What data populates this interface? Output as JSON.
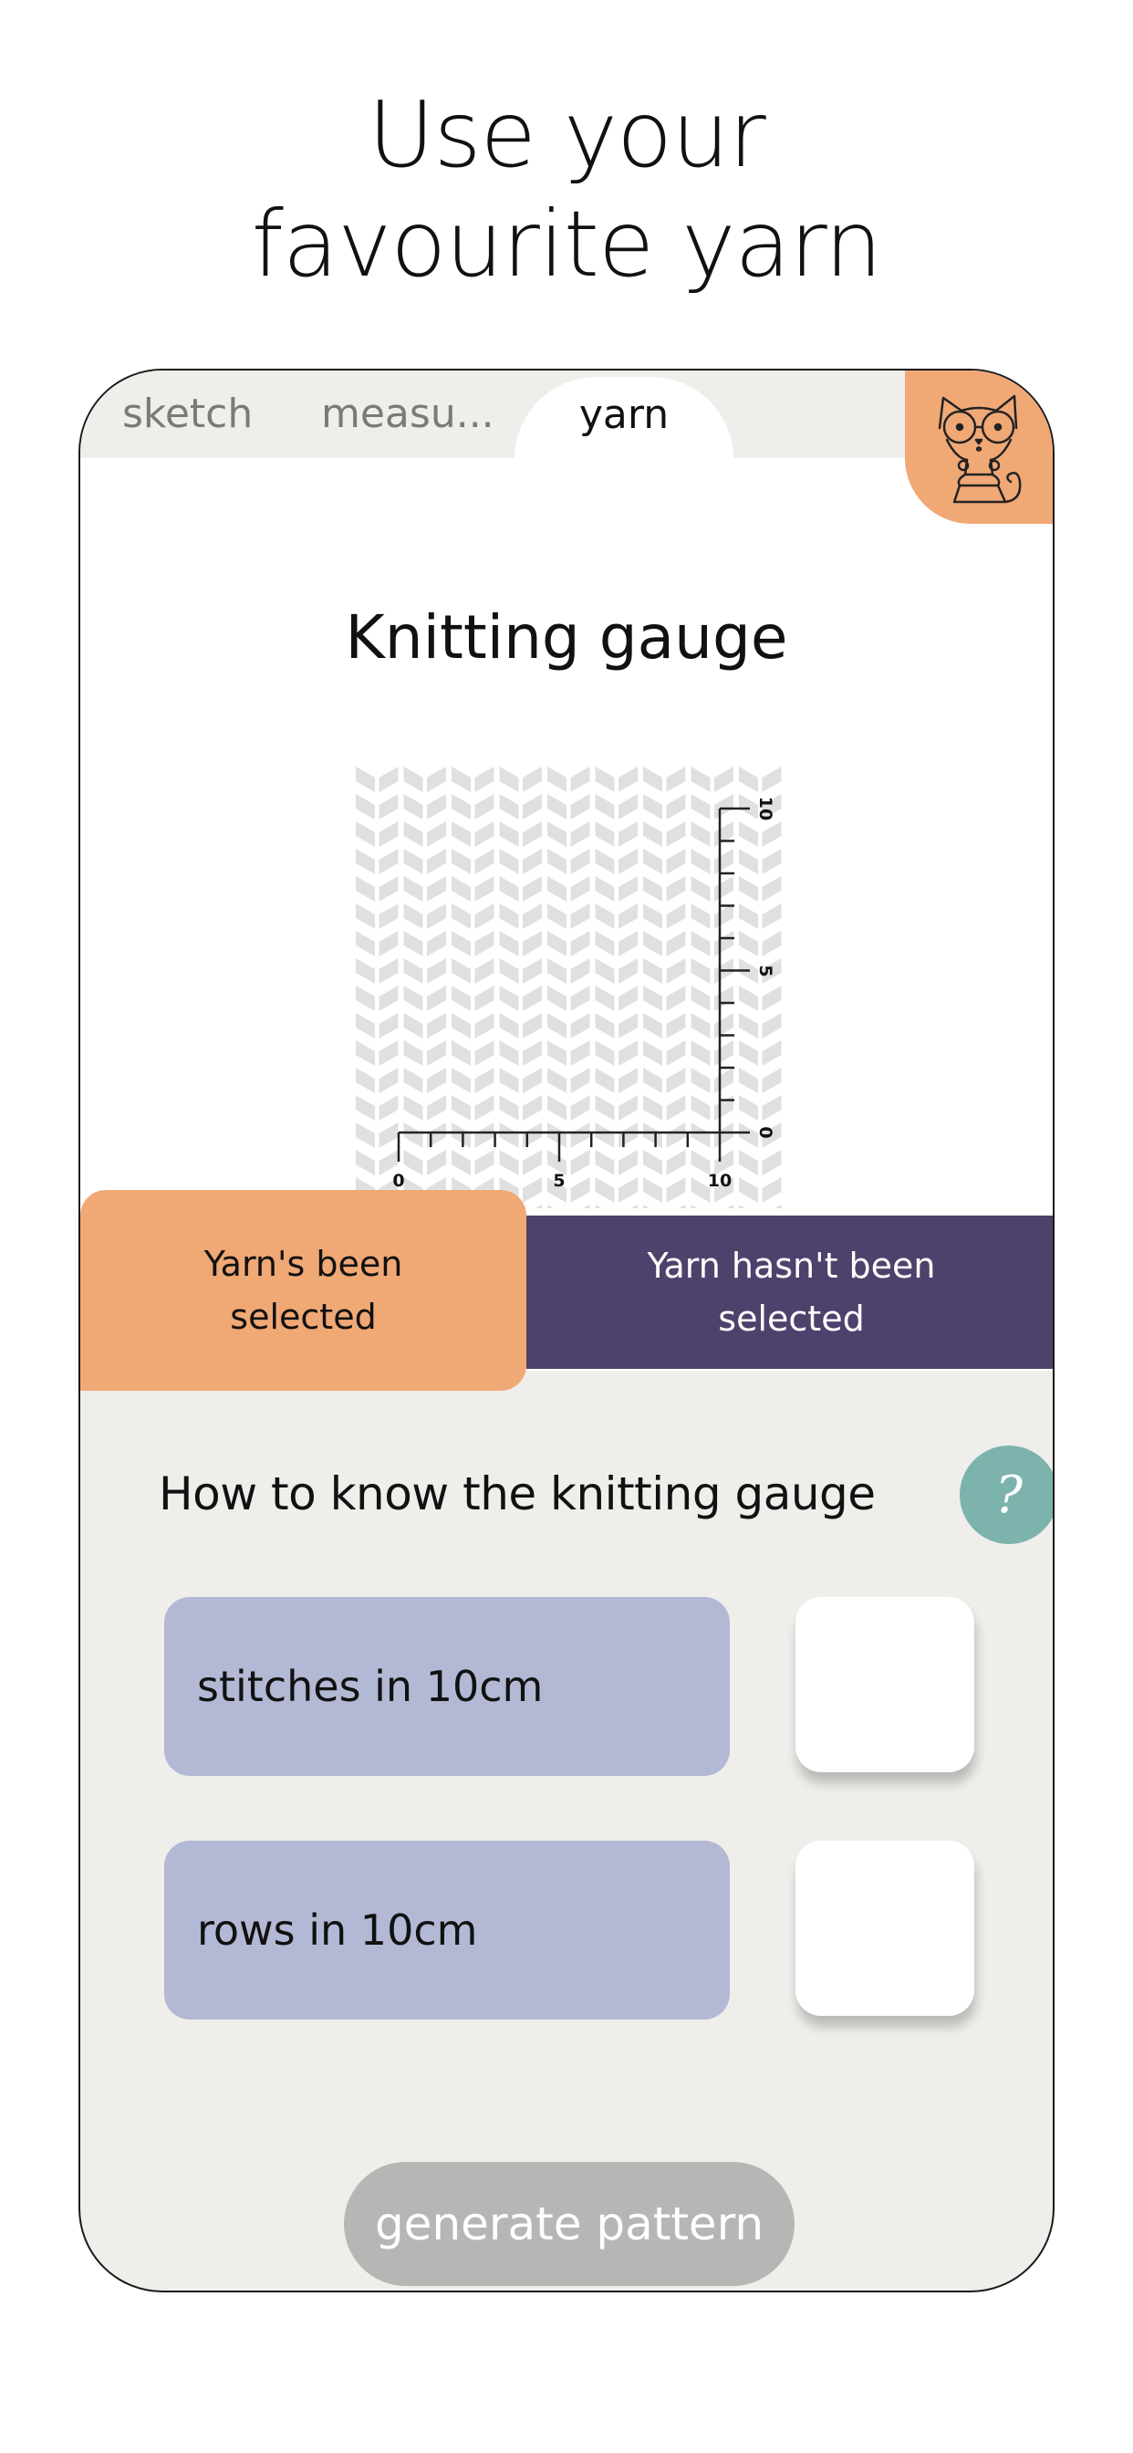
{
  "headline": {
    "line1": "Use your",
    "line2": "favourite yarn"
  },
  "tabs": [
    {
      "label": "sketch",
      "active": false
    },
    {
      "label": "measu...",
      "active": false
    },
    {
      "label": "yarn",
      "active": true
    }
  ],
  "mascot": {
    "icon": "cat-with-glasses-icon"
  },
  "gauge": {
    "title": "Knitting gauge",
    "illustration": {
      "icon": "knit-stitch-swatch",
      "horizontal_ruler_labels": [
        "0",
        "5",
        "10"
      ],
      "vertical_ruler_labels": [
        "0",
        "5",
        "10"
      ],
      "ruler_range": [
        0,
        10
      ]
    }
  },
  "yarn_toggle": {
    "selected_label": "Yarn's been selected",
    "unselected_label": "Yarn hasn't been selected",
    "active": "selected"
  },
  "help": {
    "text": "How to know the knitting gauge",
    "button_glyph": "?"
  },
  "fields": [
    {
      "label": "stitches in 10cm",
      "value": ""
    },
    {
      "label": "rows in 10cm",
      "value": ""
    }
  ],
  "generate_button": {
    "label": "generate pattern",
    "enabled": false
  },
  "colors": {
    "orange": "#f0a875",
    "purple": "#4e416b",
    "lavender": "#b3b8d4",
    "teal": "#7db3ad",
    "panel_gray": "#efeeeb",
    "button_disabled": "#b6b7b5"
  }
}
